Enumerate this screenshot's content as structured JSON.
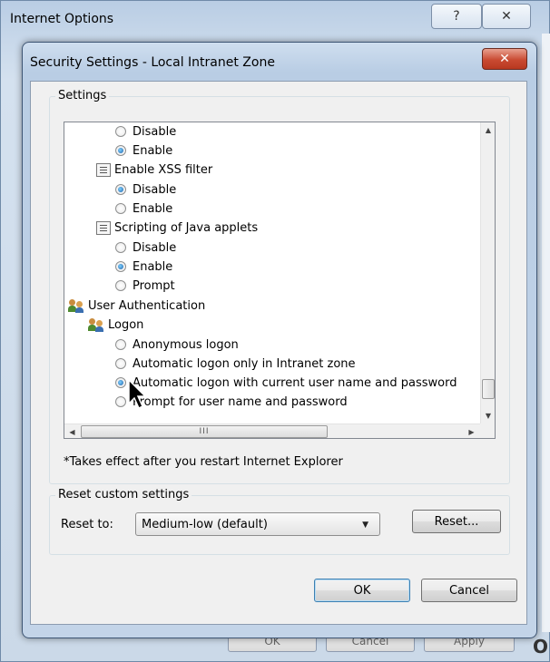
{
  "background_window": {
    "title": "Internet Options",
    "help_button": "?",
    "close_button": "✕",
    "bottom_buttons": [
      "OK",
      "Cancel",
      "Apply"
    ],
    "edge_text": "O"
  },
  "dialog": {
    "title": "Security Settings - Local Intranet Zone",
    "close_button": "✕"
  },
  "settings": {
    "group_label": "Settings",
    "items": [
      {
        "type": "radio",
        "label": "Disable",
        "checked": false
      },
      {
        "type": "radio",
        "label": "Enable",
        "checked": true
      },
      {
        "type": "setting",
        "label": "Enable XSS filter"
      },
      {
        "type": "radio",
        "label": "Disable",
        "checked": true
      },
      {
        "type": "radio",
        "label": "Enable",
        "checked": false
      },
      {
        "type": "setting",
        "label": "Scripting of Java applets"
      },
      {
        "type": "radio",
        "label": "Disable",
        "checked": false
      },
      {
        "type": "radio",
        "label": "Enable",
        "checked": true
      },
      {
        "type": "radio",
        "label": "Prompt",
        "checked": false
      },
      {
        "type": "category",
        "label": "User Authentication"
      },
      {
        "type": "subcategory",
        "label": "Logon"
      },
      {
        "type": "radio",
        "label": "Anonymous logon",
        "checked": false
      },
      {
        "type": "radio",
        "label": "Automatic logon only in Intranet zone",
        "checked": false
      },
      {
        "type": "radio",
        "label": "Automatic logon with current user name and password",
        "checked": true
      },
      {
        "type": "radio",
        "label": "Prompt for user name and password",
        "checked": false
      }
    ],
    "hscroll_grip": "III",
    "note": "*Takes effect after you restart Internet Explorer"
  },
  "reset": {
    "group_label": "Reset custom settings",
    "reset_to_label": "Reset to:",
    "selected_level": "Medium-low (default)",
    "reset_button": "Reset..."
  },
  "footer": {
    "ok_button": "OK",
    "cancel_button": "Cancel"
  }
}
